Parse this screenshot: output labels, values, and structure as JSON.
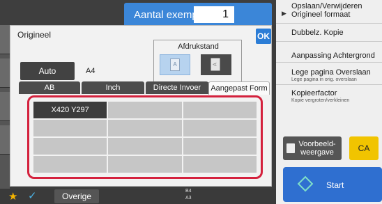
{
  "header": {
    "copies_label": "Aantal exempl.",
    "copies_value": "1"
  },
  "dialog": {
    "title": "Origineel",
    "ok_label": "OK",
    "orientation": {
      "label": "Afdrukstand",
      "portrait_glyph": "A",
      "landscape_glyph": "A",
      "selected": "portrait"
    },
    "auto_label": "Auto",
    "auto_value": "A4",
    "tabs": [
      {
        "label": "AB",
        "active": false
      },
      {
        "label": "Inch",
        "active": false
      },
      {
        "label": "Directe Invoer",
        "active": false
      },
      {
        "label": "Aangepast Form",
        "active": true
      }
    ],
    "custom_sizes": [
      "X420 Y297",
      "",
      "",
      "",
      "",
      "",
      "",
      "",
      "",
      "",
      "",
      ""
    ]
  },
  "right_panel": {
    "items": [
      {
        "label": "Opslaan/Verwijderen Origineel formaat",
        "sub": ""
      },
      {
        "label": "Dubbelz. Kopie",
        "sub": ""
      },
      {
        "label": "Aanpassing Achtergrond",
        "sub": ""
      },
      {
        "label": "Lege pagina Overslaan",
        "sub": "Lege pagina in orig. overslaan"
      },
      {
        "label": "Kopieerfactor",
        "sub": "Kopie vergroten/verkleinen"
      }
    ],
    "preview_label": "Voorbeeld-\nweergave",
    "ca_label": "CA",
    "start_label": "Start"
  },
  "bottom": {
    "overige_label": "Overige",
    "paper_info": [
      "B4",
      "A3"
    ]
  },
  "colors": {
    "accent": "#2c7dd6",
    "highlight": "#d4213d",
    "ca": "#f1c400",
    "start": "#2f6fd0"
  }
}
